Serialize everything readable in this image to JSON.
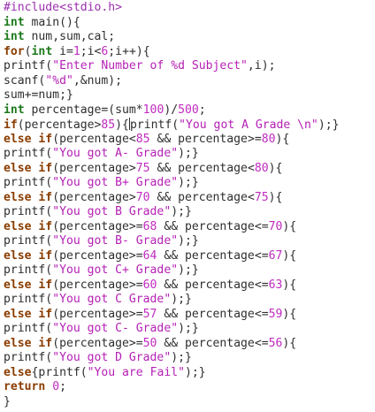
{
  "code_lines": [
    [
      {
        "t": "#include<stdio.h>",
        "c": "pre"
      }
    ],
    [
      {
        "t": "int",
        "c": "type"
      },
      {
        "t": " main(){",
        "c": "plain"
      }
    ],
    [
      {
        "t": "int",
        "c": "type"
      },
      {
        "t": " num,sum,cal;",
        "c": "plain"
      }
    ],
    [
      {
        "t": "for",
        "c": "kw"
      },
      {
        "t": "(",
        "c": "plain"
      },
      {
        "t": "int",
        "c": "type"
      },
      {
        "t": " i=",
        "c": "plain"
      },
      {
        "t": "1",
        "c": "num"
      },
      {
        "t": ";i<",
        "c": "plain"
      },
      {
        "t": "6",
        "c": "num"
      },
      {
        "t": ";i++){",
        "c": "plain"
      }
    ],
    [
      {
        "t": "printf(",
        "c": "plain"
      },
      {
        "t": "\"Enter Number of %d Subject\"",
        "c": "str"
      },
      {
        "t": ",i);",
        "c": "plain"
      }
    ],
    [
      {
        "t": "scanf(",
        "c": "plain"
      },
      {
        "t": "\"%d\"",
        "c": "str"
      },
      {
        "t": ",&num);",
        "c": "plain"
      }
    ],
    [
      {
        "t": "sum+=num;}",
        "c": "plain"
      }
    ],
    [
      {
        "t": "int",
        "c": "type"
      },
      {
        "t": " percentage=(sum*",
        "c": "plain"
      },
      {
        "t": "100",
        "c": "num"
      },
      {
        "t": ")/",
        "c": "plain"
      },
      {
        "t": "500",
        "c": "num"
      },
      {
        "t": ";",
        "c": "plain"
      }
    ],
    [
      {
        "t": "if",
        "c": "kw"
      },
      {
        "t": "(percentage>",
        "c": "plain"
      },
      {
        "t": "85",
        "c": "num"
      },
      {
        "t": "){",
        "c": "plain"
      },
      {
        "t": "|",
        "c": "cursor"
      },
      {
        "t": "printf(",
        "c": "plain"
      },
      {
        "t": "\"You got A Grade \\n\"",
        "c": "str"
      },
      {
        "t": ");}",
        "c": "plain"
      }
    ],
    [
      {
        "t": "else if",
        "c": "kw"
      },
      {
        "t": "(percentage<",
        "c": "plain"
      },
      {
        "t": "85",
        "c": "num"
      },
      {
        "t": " && percentage>=",
        "c": "plain"
      },
      {
        "t": "80",
        "c": "num"
      },
      {
        "t": "){",
        "c": "plain"
      }
    ],
    [
      {
        "t": "printf(",
        "c": "plain"
      },
      {
        "t": "\"You got A- Grade\"",
        "c": "str"
      },
      {
        "t": ");}",
        "c": "plain"
      }
    ],
    [
      {
        "t": "else if",
        "c": "kw"
      },
      {
        "t": "(percentage>",
        "c": "plain"
      },
      {
        "t": "75",
        "c": "num"
      },
      {
        "t": " && percentage<",
        "c": "plain"
      },
      {
        "t": "80",
        "c": "num"
      },
      {
        "t": "){",
        "c": "plain"
      }
    ],
    [
      {
        "t": "printf(",
        "c": "plain"
      },
      {
        "t": "\"You got B+ Grade\"",
        "c": "str"
      },
      {
        "t": ");}",
        "c": "plain"
      }
    ],
    [
      {
        "t": "else if",
        "c": "kw"
      },
      {
        "t": "(percentage>",
        "c": "plain"
      },
      {
        "t": "70",
        "c": "num"
      },
      {
        "t": " && percentage<",
        "c": "plain"
      },
      {
        "t": "75",
        "c": "num"
      },
      {
        "t": "){",
        "c": "plain"
      }
    ],
    [
      {
        "t": "printf(",
        "c": "plain"
      },
      {
        "t": "\"You got B Grade\"",
        "c": "str"
      },
      {
        "t": ");}",
        "c": "plain"
      }
    ],
    [
      {
        "t": "else if",
        "c": "kw"
      },
      {
        "t": "(percentage>=",
        "c": "plain"
      },
      {
        "t": "68",
        "c": "num"
      },
      {
        "t": " && percentage<=",
        "c": "plain"
      },
      {
        "t": "70",
        "c": "num"
      },
      {
        "t": "){",
        "c": "plain"
      }
    ],
    [
      {
        "t": "printf(",
        "c": "plain"
      },
      {
        "t": "\"You got B- Grade\"",
        "c": "str"
      },
      {
        "t": ");}",
        "c": "plain"
      }
    ],
    [
      {
        "t": "else if",
        "c": "kw"
      },
      {
        "t": "(percentage>=",
        "c": "plain"
      },
      {
        "t": "64",
        "c": "num"
      },
      {
        "t": " && percentage<=",
        "c": "plain"
      },
      {
        "t": "67",
        "c": "num"
      },
      {
        "t": "){",
        "c": "plain"
      }
    ],
    [
      {
        "t": "printf(",
        "c": "plain"
      },
      {
        "t": "\"You got C+ Grade\"",
        "c": "str"
      },
      {
        "t": ");}",
        "c": "plain"
      }
    ],
    [
      {
        "t": "else if",
        "c": "kw"
      },
      {
        "t": "(percentage>=",
        "c": "plain"
      },
      {
        "t": "60",
        "c": "num"
      },
      {
        "t": " && percentage<=",
        "c": "plain"
      },
      {
        "t": "63",
        "c": "num"
      },
      {
        "t": "){",
        "c": "plain"
      }
    ],
    [
      {
        "t": "printf(",
        "c": "plain"
      },
      {
        "t": "\"You got C Grade\"",
        "c": "str"
      },
      {
        "t": ");}",
        "c": "plain"
      }
    ],
    [
      {
        "t": "else if",
        "c": "kw"
      },
      {
        "t": "(percentage>=",
        "c": "plain"
      },
      {
        "t": "57",
        "c": "num"
      },
      {
        "t": " && percentage<=",
        "c": "plain"
      },
      {
        "t": "59",
        "c": "num"
      },
      {
        "t": "){",
        "c": "plain"
      }
    ],
    [
      {
        "t": "printf(",
        "c": "plain"
      },
      {
        "t": "\"You got C- Grade\"",
        "c": "str"
      },
      {
        "t": ");}",
        "c": "plain"
      }
    ],
    [
      {
        "t": "else if",
        "c": "kw"
      },
      {
        "t": "(percentage>=",
        "c": "plain"
      },
      {
        "t": "50",
        "c": "num"
      },
      {
        "t": " && percentage<=",
        "c": "plain"
      },
      {
        "t": "56",
        "c": "num"
      },
      {
        "t": "){",
        "c": "plain"
      }
    ],
    [
      {
        "t": "printf(",
        "c": "plain"
      },
      {
        "t": "\"You got D Grade\"",
        "c": "str"
      },
      {
        "t": ");}",
        "c": "plain"
      }
    ],
    [
      {
        "t": "else",
        "c": "kw"
      },
      {
        "t": "{printf(",
        "c": "plain"
      },
      {
        "t": "\"You are Fail\"",
        "c": "str"
      },
      {
        "t": ");}",
        "c": "plain"
      }
    ],
    [
      {
        "t": "return",
        "c": "kw"
      },
      {
        "t": " ",
        "c": "plain"
      },
      {
        "t": "0",
        "c": "num"
      },
      {
        "t": ";",
        "c": "plain"
      }
    ],
    [
      {
        "t": "}",
        "c": "plain"
      }
    ]
  ],
  "colors": {
    "background": "#ffffff",
    "plain": "#2e2e2e",
    "preprocessor": "#9b2fae",
    "type": "#1d7a1d",
    "keyword": "#8a3c00",
    "string": "#b520b5",
    "number": "#c02ac0"
  }
}
